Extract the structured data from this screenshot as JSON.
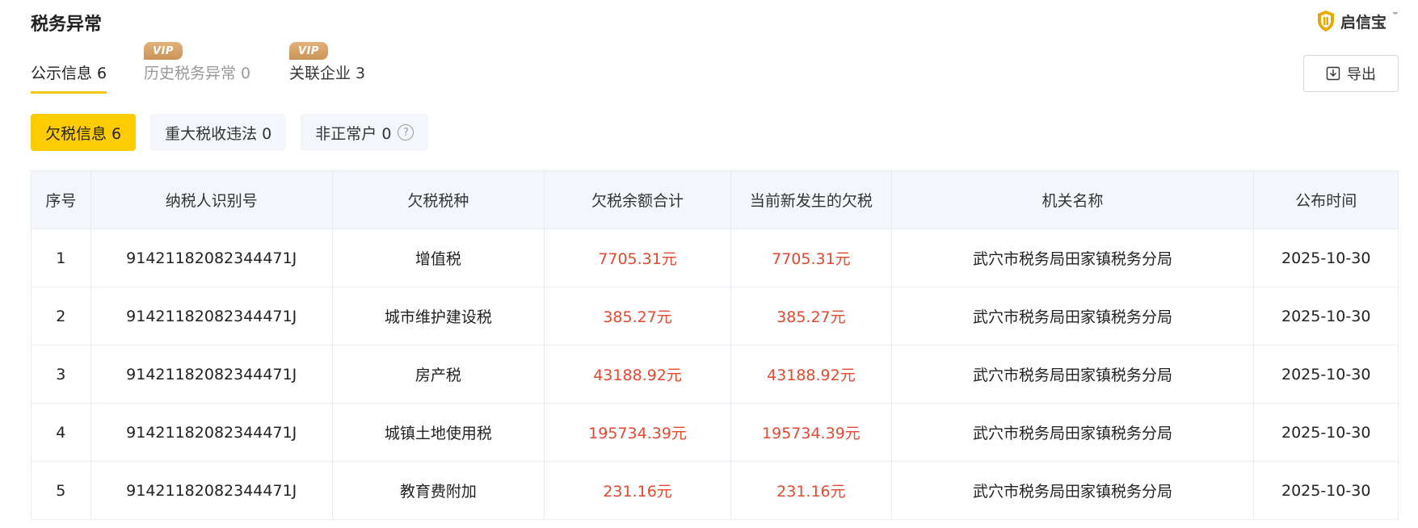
{
  "header": {
    "title": "税务异常",
    "brand": "启信宝",
    "brand_tm": "™"
  },
  "tabs": [
    {
      "label": "公示信息 6",
      "vip": false,
      "active": true
    },
    {
      "label": "历史税务异常 0",
      "vip": true,
      "active": false
    },
    {
      "label": "关联企业 3",
      "vip": true,
      "active": false
    }
  ],
  "vip_label": "VIP",
  "export": {
    "label": "导出",
    "icon": "download-icon"
  },
  "chips": [
    {
      "label": "欠税信息 6",
      "active": true
    },
    {
      "label": "重大税收违法 0",
      "active": false
    },
    {
      "label": "非正常户 0",
      "active": false,
      "help_icon": "?"
    }
  ],
  "table": {
    "headers": [
      "序号",
      "纳税人识别号",
      "欠税税种",
      "欠税余额合计",
      "当前新发生的欠税",
      "机关名称",
      "公布时间"
    ],
    "rows": [
      [
        "1",
        "9142118208234447​1J",
        "增值税",
        "7705.31元",
        "7705.31元",
        "武穴市税务局田家镇税务分局",
        "2025-10-30"
      ],
      [
        "2",
        "9142118208234447​1J",
        "城市维护建设税",
        "385.27元",
        "385.27元",
        "武穴市税务局田家镇税务分局",
        "2025-10-30"
      ],
      [
        "3",
        "9142118208234447​1J",
        "房产税",
        "43188.92元",
        "43188.92元",
        "武穴市税务局田家镇税务分局",
        "2025-10-30"
      ],
      [
        "4",
        "9142118208234447​1J",
        "城镇土地使用税",
        "195734.39元",
        "195734.39元",
        "武穴市税务局田家镇税务分局",
        "2025-10-30"
      ],
      [
        "5",
        "9142118208234447​1J",
        "教育费附加",
        "231.16元",
        "231.16元",
        "武穴市税务局田家镇税务分局",
        "2025-10-30"
      ]
    ]
  },
  "colors": {
    "accent": "#FFCC00",
    "money": "#E2492F",
    "vip": "#D4A06A"
  }
}
